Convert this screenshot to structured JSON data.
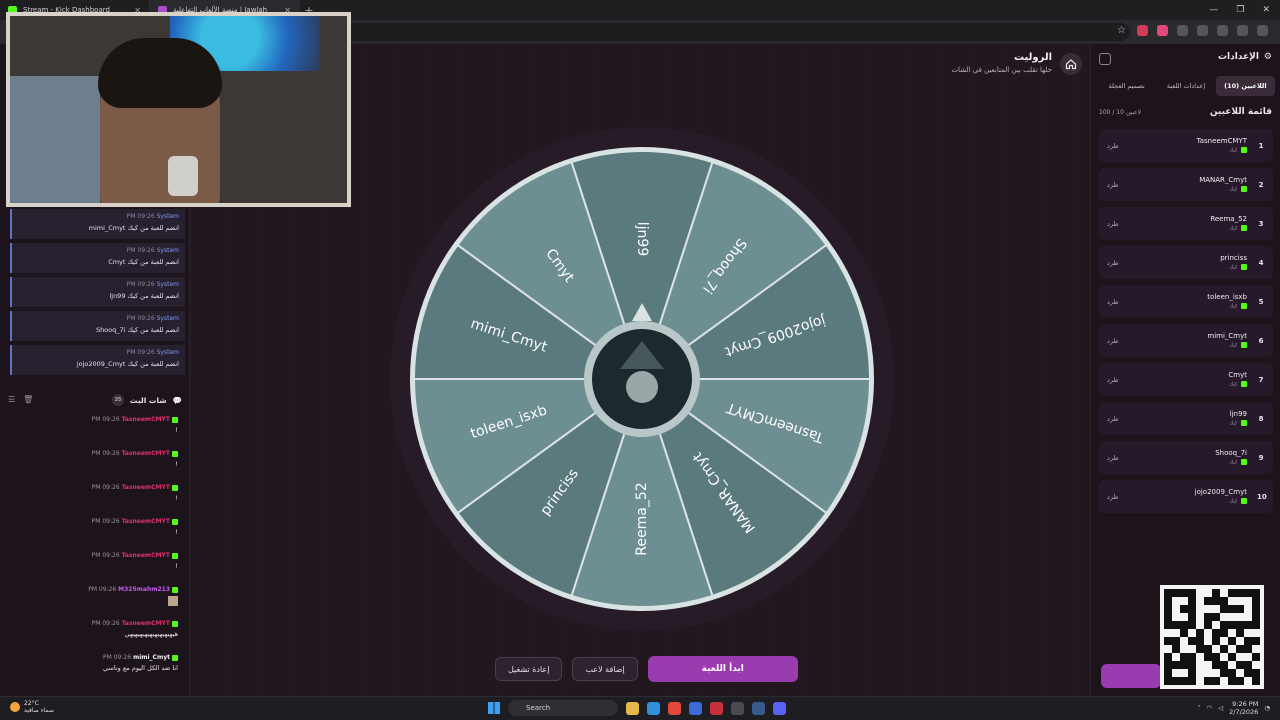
{
  "browser": {
    "tabs": [
      {
        "title": "Stream - Kick Dashboard",
        "active": false
      },
      {
        "title": "منصة الألعاب التفاعلية | Jawlah",
        "active": true
      }
    ],
    "new_tab": "+",
    "window_controls": [
      "—",
      "❐",
      "✕"
    ],
    "star": "☆"
  },
  "header": {
    "title": "الروليت",
    "subtitle": "خلها تقلب بين المتابعين في الشات"
  },
  "wheel": {
    "players": [
      "ljn99",
      "Shooq_7i",
      "jojo2009_Cmyt",
      "TasneemCMYT",
      "MANAR_Cmyt",
      "Reema_52",
      "princiss",
      "toleen_isxb",
      "mimi_Cmyt",
      "Cmyt"
    ],
    "colors": {
      "light": "#6e8f92",
      "dark": "#5b7a7e",
      "rim": "#2a1f2a",
      "outer": "#261b26"
    }
  },
  "buttons": {
    "restart": "إعادة تشغيل",
    "add_player": "إضافة لاعب",
    "start": "ابدأ اللعبة"
  },
  "system_messages": [
    {
      "time": "PM 09:26",
      "user": "System",
      "text": "mimi_Cmyt انضم للعبة من كيك"
    },
    {
      "time": "PM 09:26",
      "user": "System",
      "text": "Cmyt انضم للعبة من كيك"
    },
    {
      "time": "PM 09:26",
      "user": "System",
      "text": "ljn99 انضم للعبة من كيك"
    },
    {
      "time": "PM 09:26",
      "user": "System",
      "text": "Shooq_7i انضم للعبة من كيك"
    },
    {
      "time": "PM 09:26",
      "user": "System",
      "text": "jojo2009_Cmyt انضم للعبة من كيك"
    }
  ],
  "chat": {
    "title": "شات البث",
    "count": "35",
    "messages": [
      {
        "time": "PM 09:26",
        "user": "TasneemCMYT",
        "color": "#e0316d",
        "text": "!"
      },
      {
        "time": "PM 09:26",
        "user": "TasneemCMYT",
        "color": "#e0316d",
        "text": "!"
      },
      {
        "time": "PM 09:26",
        "user": "TasneemCMYT",
        "color": "#e0316d",
        "text": "!"
      },
      {
        "time": "PM 09:26",
        "user": "TasneemCMYT",
        "color": "#e0316d",
        "text": "!"
      },
      {
        "time": "PM 09:26",
        "user": "TasneemCMYT",
        "color": "#e0316d",
        "text": "!"
      },
      {
        "time": "PM 09:26",
        "user": "M325mahm213",
        "color": "#c55cf0",
        "text": ""
      },
      {
        "time": "PM 09:26",
        "user": "TasneemCMYT",
        "color": "#e0316d",
        "text": "هيهيهيهيهيهيهيهيهيهي"
      },
      {
        "time": "PM 09:26",
        "user": "mimi_Cmyt",
        "color": "#f2f2f2",
        "text": "انا ضد الكل اليوم مع وناسي"
      }
    ]
  },
  "settings": {
    "title": "الإعدادات",
    "tabs": [
      "اللاعبين (10)",
      "إعدادات اللعبة",
      "تصميم العجلة"
    ],
    "list_title": "قائمة اللاعبين",
    "count": "100 / 10 لاعبين",
    "kick_label": "طرد",
    "source_label": "كيك",
    "players": [
      {
        "num": "1",
        "name": "TasneemCMYT"
      },
      {
        "num": "2",
        "name": "MANAR_Cmyt"
      },
      {
        "num": "3",
        "name": "Reema_52"
      },
      {
        "num": "4",
        "name": "princiss"
      },
      {
        "num": "5",
        "name": "toleen_isxb"
      },
      {
        "num": "6",
        "name": "mimi_Cmyt"
      },
      {
        "num": "7",
        "name": "Cmyt"
      },
      {
        "num": "8",
        "name": "ljn99"
      },
      {
        "num": "9",
        "name": "Shooq_7i"
      },
      {
        "num": "10",
        "name": "jojo2009_Cmyt"
      }
    ]
  },
  "taskbar": {
    "temp": "22°C",
    "weather": "سماء صافية",
    "search": "Search",
    "time": "9:26 PM",
    "date": "2/7/2026"
  }
}
